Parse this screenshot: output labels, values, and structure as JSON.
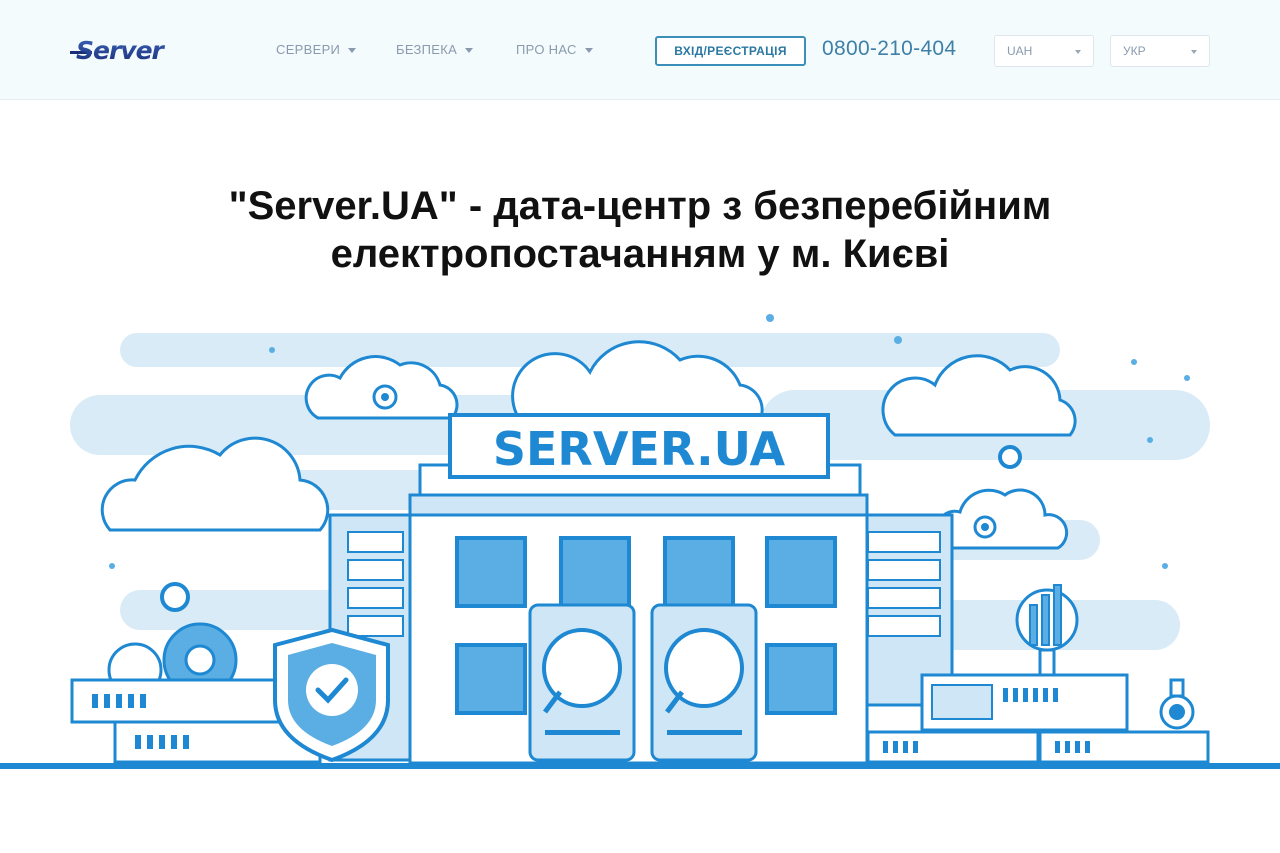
{
  "header": {
    "logo_text": "Server",
    "nav": [
      {
        "label": "СЕРВЕРИ"
      },
      {
        "label": "БЕЗПЕКА"
      },
      {
        "label": "ПРО НАС"
      }
    ],
    "login_label": "ВХІД/РЕЄСТРАЦІЯ",
    "phone": "0800-210-404",
    "currency": {
      "selected": "UAH"
    },
    "language": {
      "selected": "УКР"
    }
  },
  "hero": {
    "title_line1": "\"Server.UA\" - дата-центр з безперебійним",
    "title_line2": "електропостачанням у м. Києві",
    "building_sign": "SERVER.UA"
  },
  "colors": {
    "accent": "#1e88d2",
    "accent_light": "#cfe6f6",
    "header_bg": "#f4fbfd",
    "phone": "#3f80a8"
  }
}
